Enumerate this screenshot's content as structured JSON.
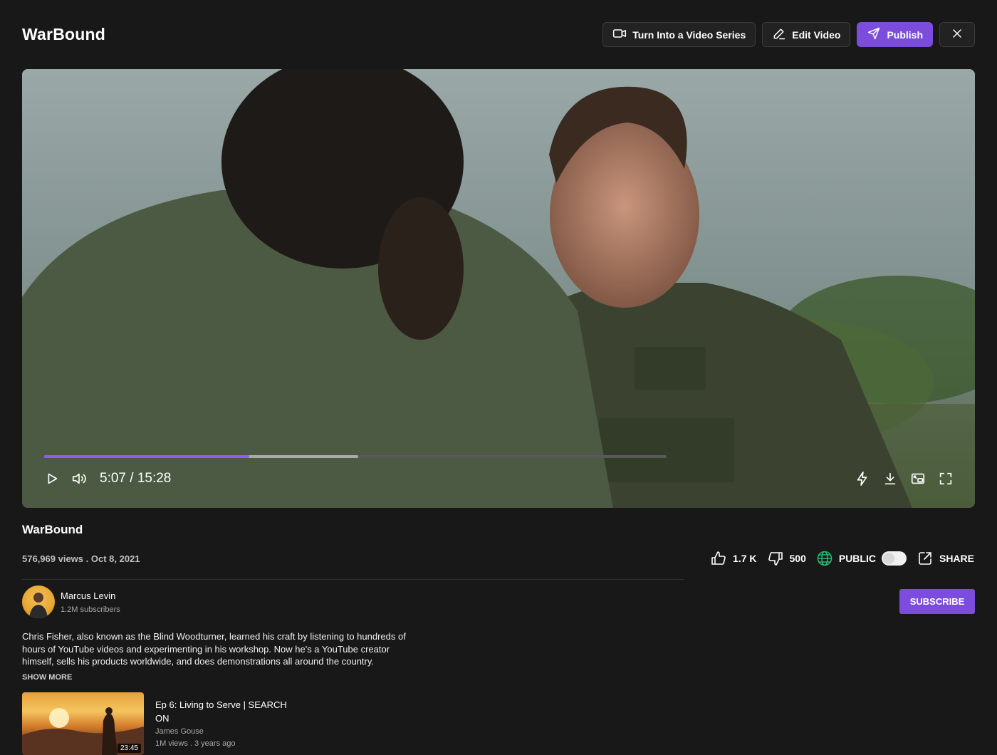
{
  "app": {
    "title": "WarBound"
  },
  "header": {
    "series_label": "Turn Into a Video Series",
    "edit_label": "Edit Video",
    "publish_label": "Publish"
  },
  "player": {
    "time": "5:07 / 15:28",
    "played_fraction": 0.33,
    "buffered_fraction": 0.505
  },
  "video": {
    "title": "WarBound",
    "meta": "576,969 views . Oct 8, 2021",
    "likes": "1.7 K",
    "dislikes": "500",
    "visibility": "PUBLIC",
    "share_label": "SHARE"
  },
  "channel": {
    "name": "Marcus Levin",
    "subscribers": "1.2M subscribers",
    "subscribe_label": "SUBSCRIBE"
  },
  "description": {
    "text": "Chris Fisher, also known as the Blind Woodturner, learned his craft by listening to hundreds of hours of YouTube videos and experimenting in his workshop. Now he's a YouTube creator himself, sells his products worldwide, and does demonstrations all around the country.",
    "show_more": "SHOW MORE"
  },
  "recommendation": {
    "title": "Ep 6: Living to Serve | SEARCH ON",
    "author": "James Gouse",
    "stats": "1M views . 3 years ago",
    "duration": "23:45"
  },
  "colors": {
    "accent": "#7c4ddc",
    "progress": "#8b5cf6",
    "globe": "#2bb673"
  }
}
